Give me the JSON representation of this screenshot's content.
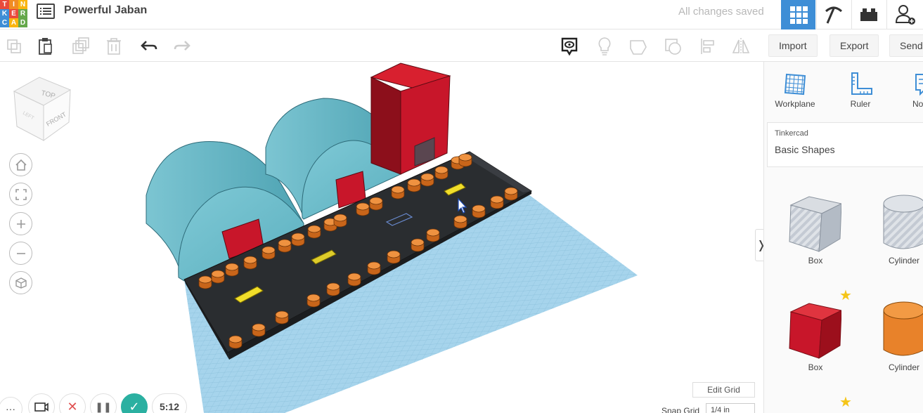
{
  "app": {
    "logo_letters": [
      "T",
      "I",
      "N",
      "K",
      "E",
      "R",
      "C",
      "A",
      "D"
    ],
    "logo_colors": [
      "#e94b3c",
      "#f18c22",
      "#f9b50f",
      "#3e8ed6",
      "#e94b3c",
      "#66a84b",
      "#3e8ed6",
      "#f9b50f",
      "#66a84b"
    ],
    "title": "Powerful Jaban",
    "save_status": "All changes saved"
  },
  "toolbar": {
    "import_label": "Import",
    "export_label": "Export",
    "send_label": "Send"
  },
  "panel": {
    "tools": [
      {
        "label": "Workplane",
        "icon": "workplane-icon"
      },
      {
        "label": "Ruler",
        "icon": "ruler-icon"
      },
      {
        "label": "No",
        "icon": "notes-icon"
      }
    ],
    "library_source": "Tinkercad",
    "library_name": "Basic Shapes",
    "shapes": [
      {
        "label": "Box",
        "color": "#b8c0cc"
      },
      {
        "label": "Cylinder",
        "color": "#b8c0cc"
      },
      {
        "label": "Box",
        "color": "#d2202b"
      },
      {
        "label": "Cylinder",
        "color": "#e87b14"
      }
    ]
  },
  "viewcube": {
    "top": "TOP",
    "front": "FRONT",
    "left": "LEFT"
  },
  "bottom": {
    "timer": "5:12",
    "edit_grid_label": "Edit Grid",
    "snap_grid_label": "Snap Grid",
    "snap_grid_value": "1/4 in"
  },
  "colors": {
    "accent": "#3e8ed6",
    "workplane": "#a6d4ec",
    "dome": "#62b8c8",
    "red": "#c8162a",
    "orange": "#e8822a",
    "base": "#2a2d30",
    "yellow": "#f1de2a",
    "confirm": "#2bb0a1"
  }
}
